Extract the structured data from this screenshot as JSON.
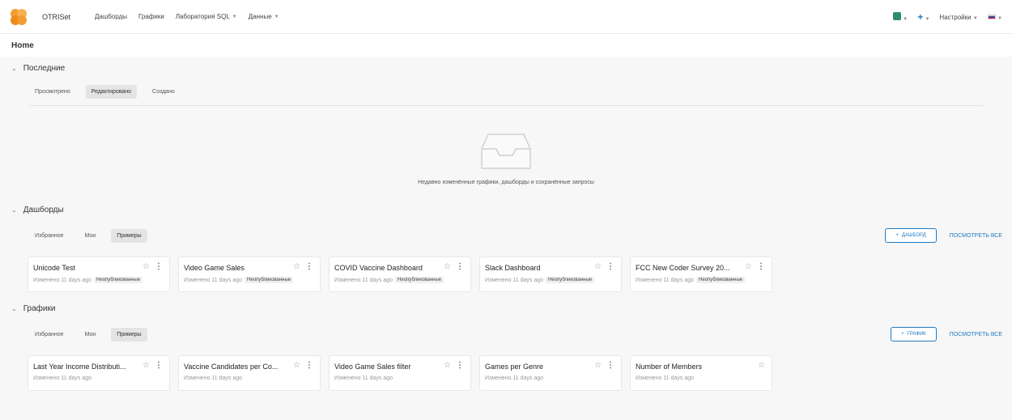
{
  "navbar": {
    "brand": "OTRISet",
    "items": [
      {
        "label": "Дашборды",
        "dropdown": false
      },
      {
        "label": "Графики",
        "dropdown": false
      },
      {
        "label": "Лаборатория SQL",
        "dropdown": true
      },
      {
        "label": "Данные",
        "dropdown": true
      }
    ],
    "settings_label": "Настройки"
  },
  "page_title": "Home",
  "recent": {
    "title": "Последние",
    "tabs": [
      "Просмотрено",
      "Редактировано",
      "Создано"
    ],
    "active_tab": 1,
    "empty_text": "Недавно изменённые графики, дашборды и сохранённые запросы"
  },
  "dashboards": {
    "title": "Дашборды",
    "tabs": [
      "Избранное",
      "Мои",
      "Примеры"
    ],
    "active_tab": 2,
    "add_button": "ДАШБОРД",
    "view_all": "ПОСМОТРЕТЬ ВСЕ",
    "items": [
      {
        "title": "Unicode Test",
        "modified": "Изменено 11 days ago",
        "badge": "Неопубликованные"
      },
      {
        "title": "Video Game Sales",
        "modified": "Изменено 11 days ago",
        "badge": "Неопубликованные"
      },
      {
        "title": "COVID Vaccine Dashboard",
        "modified": "Изменено 11 days ago",
        "badge": "Неопубликованные"
      },
      {
        "title": "Slack Dashboard",
        "modified": "Изменено 11 days ago",
        "badge": "Неопубликованные"
      },
      {
        "title": "FCC New Coder Survey 20...",
        "modified": "Изменено 11 days ago",
        "badge": "Неопубликованные"
      }
    ]
  },
  "charts": {
    "title": "Графики",
    "tabs": [
      "Избранное",
      "Мои",
      "Примеры"
    ],
    "active_tab": 2,
    "add_button": "ГРАФИК",
    "view_all": "ПОСМОТРЕТЬ ВСЕ",
    "items": [
      {
        "title": "Last Year Income Distributi...",
        "modified": "Изменено 11 days ago"
      },
      {
        "title": "Vaccine Candidates per Co...",
        "modified": "Изменено 11 days ago"
      },
      {
        "title": "Video Game Sales filter",
        "modified": "Изменено 11 days ago"
      },
      {
        "title": "Games per Genre",
        "modified": "Изменено 11 days ago"
      },
      {
        "title": "Number of Members",
        "modified": "Изменено 11 days ago"
      }
    ]
  },
  "colors": {
    "accent": "#1f7ac3",
    "logo_orange": "#f39c33"
  }
}
